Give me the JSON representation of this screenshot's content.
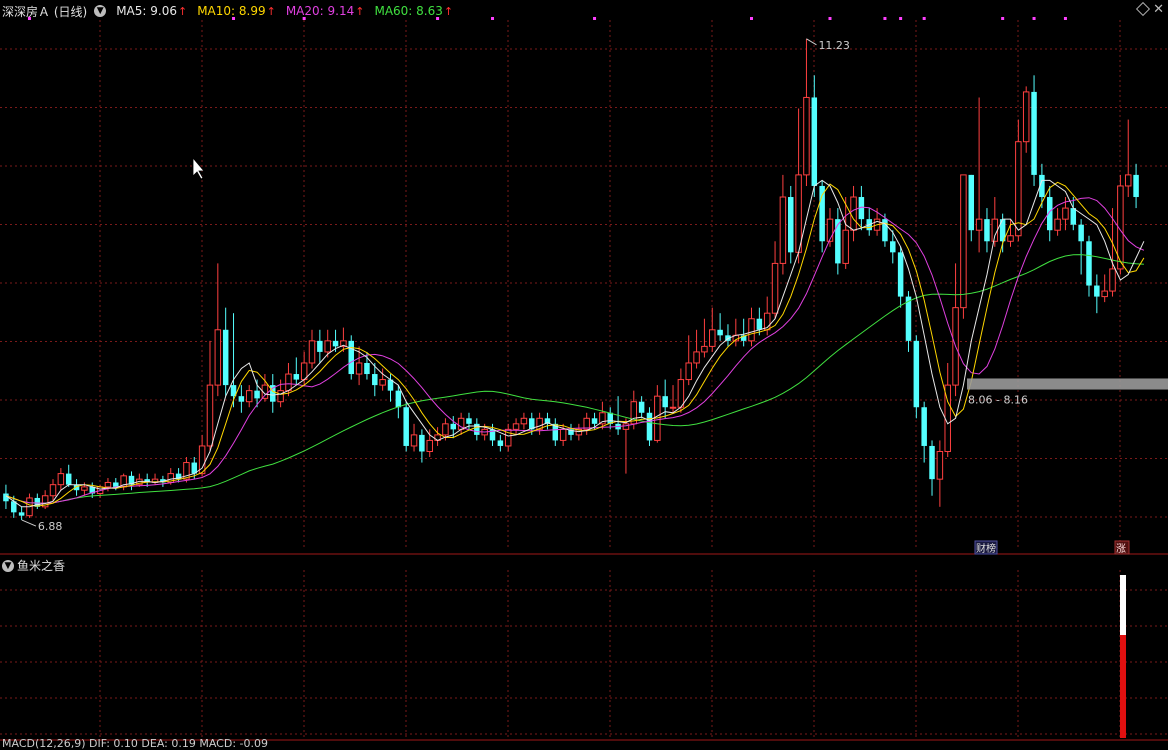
{
  "header": {
    "stock_title": "深深房Ａ (日线)",
    "ma5": {
      "label": "MA5: 9.06",
      "color": "#e8e8e8"
    },
    "ma10": {
      "label": "MA10: 8.99",
      "color": "#ffd700"
    },
    "ma20": {
      "label": "MA20: 9.14",
      "color": "#e040e0"
    },
    "ma60": {
      "label": "MA60: 8.63",
      "color": "#40e040"
    },
    "arrow": "↑"
  },
  "sub_panel": {
    "title": "鱼米之香"
  },
  "bottom_header": {
    "text": "MACD(12,26,9)  DIF: 0.10  DEA: 0.19  MACD: -0.09"
  },
  "labels": {
    "high": "11.23",
    "low": "6.88",
    "range": "8.06 - 8.16",
    "badge_cai": "财榜",
    "badge_zhang": "涨"
  },
  "colors": {
    "up": "#ff4040",
    "down": "#54ffff",
    "grid": "#7a1a1a",
    "ma5": "#e8e8e8",
    "ma10": "#ffd700",
    "ma20": "#e040e0",
    "ma60": "#40e040"
  },
  "chart_data": {
    "type": "candlestick",
    "title": "深深房Ａ (日线)",
    "ylim": [
      6.7,
      11.4
    ],
    "candles": [
      [
        7.12,
        7.05,
        7.2,
        6.98
      ],
      [
        7.05,
        6.95,
        7.1,
        6.9
      ],
      [
        6.95,
        6.92,
        7.0,
        6.88
      ],
      [
        6.92,
        7.08,
        7.12,
        6.9
      ],
      [
        7.08,
        7.0,
        7.12,
        6.98
      ],
      [
        7.0,
        7.1,
        7.15,
        6.98
      ],
      [
        7.1,
        7.2,
        7.25,
        7.05
      ],
      [
        7.2,
        7.3,
        7.35,
        7.15
      ],
      [
        7.3,
        7.2,
        7.38,
        7.18
      ],
      [
        7.2,
        7.15,
        7.25,
        7.1
      ],
      [
        7.15,
        7.18,
        7.22,
        7.1
      ],
      [
        7.18,
        7.12,
        7.22,
        7.08
      ],
      [
        7.12,
        7.18,
        7.2,
        7.08
      ],
      [
        7.18,
        7.22,
        7.26,
        7.14
      ],
      [
        7.22,
        7.18,
        7.26,
        7.15
      ],
      [
        7.18,
        7.28,
        7.3,
        7.15
      ],
      [
        7.28,
        7.2,
        7.32,
        7.15
      ],
      [
        7.2,
        7.25,
        7.3,
        7.18
      ],
      [
        7.25,
        7.22,
        7.3,
        7.18
      ],
      [
        7.22,
        7.25,
        7.3,
        7.2
      ],
      [
        7.25,
        7.22,
        7.28,
        7.18
      ],
      [
        7.22,
        7.3,
        7.35,
        7.2
      ],
      [
        7.3,
        7.25,
        7.35,
        7.22
      ],
      [
        7.25,
        7.4,
        7.45,
        7.22
      ],
      [
        7.4,
        7.3,
        7.45,
        7.25
      ],
      [
        7.3,
        7.55,
        7.65,
        7.28
      ],
      [
        7.55,
        8.1,
        8.5,
        7.5
      ],
      [
        8.1,
        8.6,
        9.2,
        8.0
      ],
      [
        8.6,
        8.1,
        8.8,
        8.0
      ],
      [
        8.1,
        8.0,
        8.75,
        7.9
      ],
      [
        8.0,
        7.95,
        8.1,
        7.85
      ],
      [
        7.95,
        8.05,
        8.1,
        7.9
      ],
      [
        8.05,
        7.98,
        8.15,
        7.9
      ],
      [
        7.98,
        8.1,
        8.2,
        7.95
      ],
      [
        8.1,
        7.95,
        8.2,
        7.85
      ],
      [
        7.95,
        8.05,
        8.15,
        7.9
      ],
      [
        8.05,
        8.2,
        8.3,
        8.0
      ],
      [
        8.2,
        8.15,
        8.35,
        8.1
      ],
      [
        8.15,
        8.3,
        8.4,
        8.1
      ],
      [
        8.3,
        8.5,
        8.6,
        8.25
      ],
      [
        8.5,
        8.4,
        8.6,
        8.3
      ],
      [
        8.4,
        8.5,
        8.6,
        8.35
      ],
      [
        8.5,
        8.45,
        8.6,
        8.4
      ],
      [
        8.45,
        8.5,
        8.62,
        8.4
      ],
      [
        8.5,
        8.2,
        8.55,
        8.15
      ],
      [
        8.2,
        8.3,
        8.45,
        8.1
      ],
      [
        8.3,
        8.2,
        8.4,
        8.15
      ],
      [
        8.2,
        8.1,
        8.3,
        8.0
      ],
      [
        8.1,
        8.15,
        8.25,
        8.05
      ],
      [
        8.15,
        8.05,
        8.2,
        7.95
      ],
      [
        8.05,
        7.9,
        8.1,
        7.8
      ],
      [
        7.9,
        7.55,
        7.95,
        7.5
      ],
      [
        7.55,
        7.65,
        7.75,
        7.5
      ],
      [
        7.65,
        7.5,
        7.7,
        7.4
      ],
      [
        7.5,
        7.6,
        7.7,
        7.45
      ],
      [
        7.6,
        7.65,
        7.72,
        7.55
      ],
      [
        7.65,
        7.75,
        7.8,
        7.6
      ],
      [
        7.75,
        7.7,
        7.82,
        7.62
      ],
      [
        7.7,
        7.8,
        7.85,
        7.65
      ],
      [
        7.8,
        7.75,
        7.85,
        7.7
      ],
      [
        7.75,
        7.65,
        7.8,
        7.6
      ],
      [
        7.65,
        7.7,
        7.75,
        7.6
      ],
      [
        7.7,
        7.6,
        7.75,
        7.55
      ],
      [
        7.6,
        7.55,
        7.65,
        7.5
      ],
      [
        7.55,
        7.7,
        7.75,
        7.5
      ],
      [
        7.7,
        7.75,
        7.8,
        7.65
      ],
      [
        7.75,
        7.8,
        7.85,
        7.7
      ],
      [
        7.8,
        7.7,
        7.85,
        7.65
      ],
      [
        7.7,
        7.8,
        7.85,
        7.65
      ],
      [
        7.8,
        7.75,
        7.85,
        7.7
      ],
      [
        7.75,
        7.6,
        7.8,
        7.55
      ],
      [
        7.6,
        7.7,
        7.75,
        7.55
      ],
      [
        7.7,
        7.65,
        7.75,
        7.6
      ],
      [
        7.65,
        7.7,
        7.75,
        7.6
      ],
      [
        7.7,
        7.8,
        7.85,
        7.65
      ],
      [
        7.8,
        7.75,
        7.85,
        7.7
      ],
      [
        7.75,
        7.85,
        7.95,
        7.7
      ],
      [
        7.85,
        7.75,
        7.9,
        7.7
      ],
      [
        7.75,
        7.7,
        8.0,
        7.65
      ],
      [
        7.7,
        7.75,
        7.8,
        7.3
      ],
      [
        7.75,
        7.95,
        8.05,
        7.7
      ],
      [
        7.95,
        7.85,
        8.0,
        7.8
      ],
      [
        7.85,
        7.6,
        7.9,
        7.55
      ],
      [
        7.6,
        8.0,
        8.1,
        7.58
      ],
      [
        8.0,
        7.9,
        8.15,
        7.8
      ],
      [
        7.9,
        7.9,
        8.1,
        7.85
      ],
      [
        7.9,
        8.15,
        8.25,
        7.85
      ],
      [
        8.15,
        8.3,
        8.55,
        8.1
      ],
      [
        8.3,
        8.4,
        8.6,
        8.25
      ],
      [
        8.4,
        8.45,
        8.7,
        8.35
      ],
      [
        8.45,
        8.6,
        8.8,
        8.4
      ],
      [
        8.6,
        8.55,
        8.75,
        8.5
      ],
      [
        8.55,
        8.5,
        8.65,
        8.45
      ],
      [
        8.5,
        8.55,
        8.7,
        8.45
      ],
      [
        8.55,
        8.5,
        8.7,
        8.45
      ],
      [
        8.5,
        8.7,
        8.8,
        8.45
      ],
      [
        8.7,
        8.6,
        8.8,
        8.55
      ],
      [
        8.6,
        8.75,
        8.9,
        8.55
      ],
      [
        8.75,
        9.2,
        9.4,
        8.7
      ],
      [
        9.2,
        9.8,
        10.0,
        9.1
      ],
      [
        9.8,
        9.3,
        9.9,
        9.2
      ],
      [
        9.3,
        10.0,
        10.6,
        9.2
      ],
      [
        10.0,
        10.7,
        11.23,
        9.9
      ],
      [
        10.7,
        9.9,
        10.9,
        9.8
      ],
      [
        9.9,
        9.4,
        9.95,
        9.3
      ],
      [
        9.4,
        9.6,
        9.7,
        9.35
      ],
      [
        9.6,
        9.2,
        9.7,
        9.1
      ],
      [
        9.2,
        9.5,
        9.8,
        9.15
      ],
      [
        9.5,
        9.8,
        9.9,
        9.4
      ],
      [
        9.8,
        9.6,
        9.9,
        9.5
      ],
      [
        9.6,
        9.5,
        9.7,
        9.45
      ],
      [
        9.5,
        9.6,
        9.7,
        9.45
      ],
      [
        9.6,
        9.4,
        9.65,
        9.35
      ],
      [
        9.4,
        9.3,
        9.5,
        9.2
      ],
      [
        9.3,
        8.9,
        9.35,
        8.8
      ],
      [
        8.9,
        8.5,
        8.95,
        8.4
      ],
      [
        8.5,
        7.9,
        8.55,
        7.8
      ],
      [
        7.9,
        7.55,
        7.95,
        7.4
      ],
      [
        7.55,
        7.25,
        7.6,
        7.1
      ],
      [
        7.25,
        7.5,
        7.6,
        7.0
      ],
      [
        7.5,
        8.1,
        8.3,
        7.45
      ],
      [
        8.1,
        8.8,
        9.2,
        8.0
      ],
      [
        8.8,
        10.0,
        10.0,
        8.7
      ],
      [
        10.0,
        9.5,
        10.0,
        9.4
      ],
      [
        9.5,
        9.6,
        10.7,
        9.3
      ],
      [
        9.6,
        9.4,
        9.7,
        9.3
      ],
      [
        9.4,
        9.6,
        9.8,
        9.35
      ],
      [
        9.6,
        9.4,
        9.65,
        9.3
      ],
      [
        9.4,
        9.45,
        9.6,
        9.35
      ],
      [
        9.45,
        10.3,
        10.5,
        9.4
      ],
      [
        10.3,
        10.75,
        10.8,
        10.2
      ],
      [
        10.75,
        10.0,
        10.9,
        9.9
      ],
      [
        10.0,
        9.8,
        10.1,
        9.7
      ],
      [
        9.8,
        9.5,
        9.9,
        9.4
      ],
      [
        9.5,
        9.6,
        9.7,
        9.45
      ],
      [
        9.6,
        9.7,
        9.8,
        9.5
      ],
      [
        9.7,
        9.55,
        9.8,
        9.5
      ],
      [
        9.55,
        9.4,
        9.6,
        9.1
      ],
      [
        9.4,
        9.0,
        9.45,
        8.9
      ],
      [
        9.0,
        8.9,
        9.1,
        8.75
      ],
      [
        8.9,
        8.95,
        9.1,
        8.85
      ],
      [
        8.95,
        9.15,
        9.7,
        8.9
      ],
      [
        9.15,
        9.9,
        10.0,
        9.1
      ],
      [
        9.9,
        10.0,
        10.5,
        9.8
      ],
      [
        10.0,
        9.8,
        10.1,
        9.7
      ]
    ],
    "ma5": [
      7.1,
      7.05,
      7.0,
      7.0,
      7.02,
      7.03,
      7.05,
      7.15,
      7.2,
      7.2,
      7.2,
      7.18,
      7.16,
      7.17,
      7.17,
      7.2,
      7.21,
      7.23,
      7.23,
      7.22,
      7.23,
      7.25,
      7.26,
      7.28,
      7.3,
      7.35,
      7.5,
      7.75,
      8.0,
      8.15,
      8.25,
      8.3,
      8.1,
      8.02,
      8.01,
      8.02,
      8.05,
      8.1,
      8.15,
      8.22,
      8.3,
      8.38,
      8.43,
      8.46,
      8.43,
      8.4,
      8.35,
      8.27,
      8.2,
      8.15,
      8.1,
      7.95,
      7.85,
      7.75,
      7.65,
      7.6,
      7.63,
      7.65,
      7.7,
      7.73,
      7.73,
      7.72,
      7.7,
      7.67,
      7.64,
      7.65,
      7.68,
      7.71,
      7.73,
      7.76,
      7.73,
      7.71,
      7.69,
      7.68,
      7.69,
      7.72,
      7.77,
      7.78,
      7.77,
      7.76,
      7.8,
      7.81,
      7.78,
      7.82,
      7.86,
      7.85,
      7.9,
      8.0,
      8.14,
      8.26,
      8.36,
      8.46,
      8.52,
      8.55,
      8.56,
      8.58,
      8.6,
      8.62,
      8.7,
      8.9,
      9.1,
      9.3,
      9.6,
      9.9,
      9.95,
      9.9,
      9.75,
      9.55,
      9.5,
      9.52,
      9.55,
      9.58,
      9.56,
      9.48,
      9.35,
      9.15,
      8.9,
      8.55,
      8.2,
      7.9,
      7.75,
      7.8,
      8.1,
      8.5,
      8.8,
      9.1,
      9.45,
      9.6,
      9.6,
      9.5,
      9.55,
      9.75,
      9.95,
      9.95,
      9.9,
      9.85,
      9.7,
      9.65,
      9.6,
      9.55,
      9.4,
      9.2,
      9.05,
      9.1,
      9.25,
      9.4
    ]
  }
}
